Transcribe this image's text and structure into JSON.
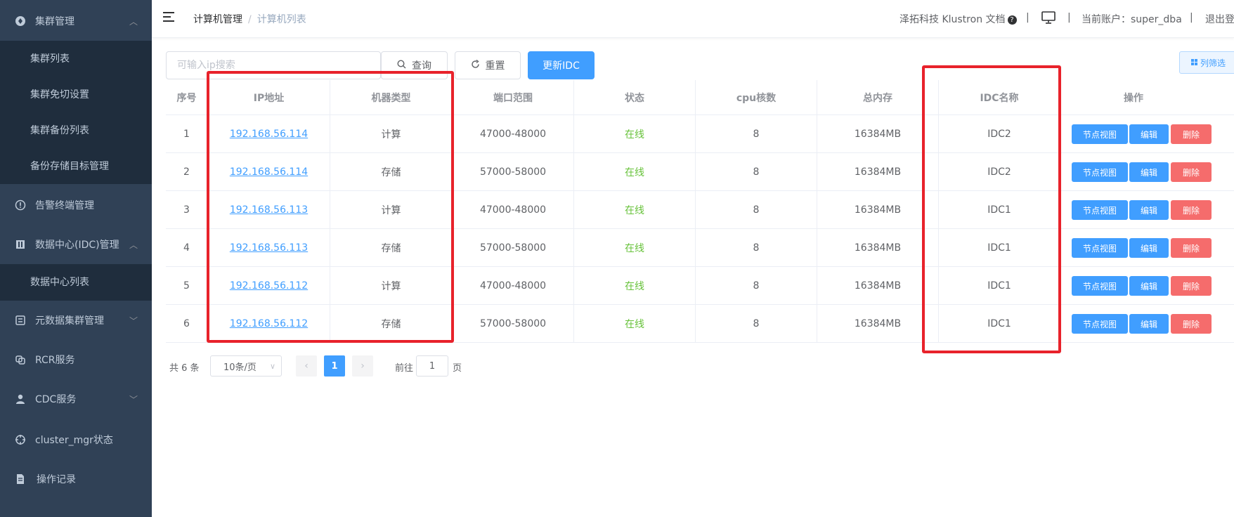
{
  "sidebar": {
    "items": [
      {
        "label": "集群管理",
        "icon": "cluster-icon",
        "chevron": "up"
      },
      {
        "label": "告警终端管理",
        "icon": "alert-circle-icon"
      },
      {
        "label": "数据中心(IDC)管理",
        "icon": "building-icon",
        "chevron": "up"
      },
      {
        "label": "元数据集群管理",
        "icon": "metadata-icon",
        "chevron": "down"
      },
      {
        "label": "RCR服务",
        "icon": "rcr-icon"
      },
      {
        "label": "CDC服务",
        "icon": "user-icon",
        "chevron": "down"
      },
      {
        "label": "cluster_mgr状态",
        "icon": "crosshair-icon"
      },
      {
        "label": "操作记录",
        "icon": "document-icon"
      }
    ],
    "cluster_sub": [
      "集群列表",
      "集群免切设置",
      "集群备份列表",
      "备份存储目标管理"
    ],
    "idc_sub": [
      "数据中心列表"
    ]
  },
  "header": {
    "breadcrumb": [
      "计算机管理",
      "计算机列表"
    ],
    "docs_link": "泽拓科技 Klustron 文档",
    "account": "当前账户：super_dba",
    "logout": "退出登",
    "divider": "|"
  },
  "toolbar": {
    "search_placeholder": "可输入ip搜索",
    "query_label": "查询",
    "reset_label": "重置",
    "update_idc_label": "更新IDC",
    "column_filter_label": "列筛选"
  },
  "table": {
    "columns": [
      "序号",
      "IP地址",
      "机器类型",
      "端口范围",
      "状态",
      "cpu核数",
      "总内存",
      "IDC名称",
      "操作"
    ],
    "rows": [
      {
        "no": "1",
        "ip": "192.168.56.114",
        "type": "计算",
        "ports": "47000-48000",
        "status": "在线",
        "cpu": "8",
        "mem": "16384MB",
        "idc": "IDC2"
      },
      {
        "no": "2",
        "ip": "192.168.56.114",
        "type": "存储",
        "ports": "57000-58000",
        "status": "在线",
        "cpu": "8",
        "mem": "16384MB",
        "idc": "IDC2"
      },
      {
        "no": "3",
        "ip": "192.168.56.113",
        "type": "计算",
        "ports": "47000-48000",
        "status": "在线",
        "cpu": "8",
        "mem": "16384MB",
        "idc": "IDC1"
      },
      {
        "no": "4",
        "ip": "192.168.56.113",
        "type": "存储",
        "ports": "57000-58000",
        "status": "在线",
        "cpu": "8",
        "mem": "16384MB",
        "idc": "IDC1"
      },
      {
        "no": "5",
        "ip": "192.168.56.112",
        "type": "计算",
        "ports": "47000-48000",
        "status": "在线",
        "cpu": "8",
        "mem": "16384MB",
        "idc": "IDC1"
      },
      {
        "no": "6",
        "ip": "192.168.56.112",
        "type": "存储",
        "ports": "57000-58000",
        "status": "在线",
        "cpu": "8",
        "mem": "16384MB",
        "idc": "IDC1"
      }
    ],
    "actions": {
      "view": "节点视图",
      "edit": "编辑",
      "delete": "删除"
    }
  },
  "pagination": {
    "total": "共 6 条",
    "page_size": "10条/页",
    "current_page": "1",
    "goto_prefix": "前往",
    "goto_value": "1",
    "goto_suffix": "页"
  },
  "colors": {
    "sidebar_bg": "#304156",
    "submenu_bg": "#1f2d3d",
    "primary": "#409eff",
    "danger": "#f56c6c",
    "success": "#67c23a",
    "annotation": "#e8222b"
  }
}
